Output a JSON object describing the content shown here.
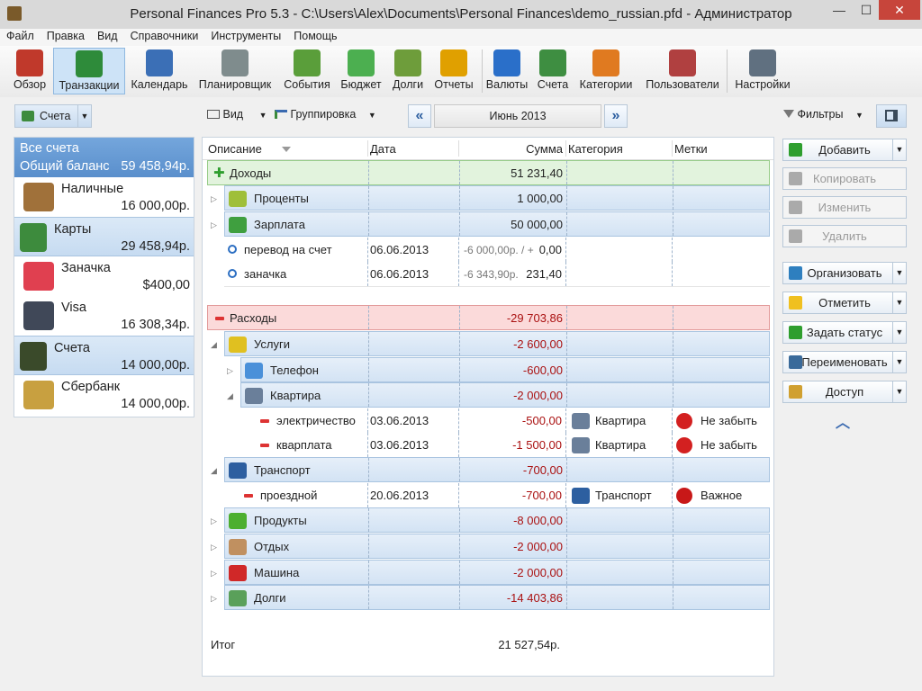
{
  "window": {
    "title": "Personal Finances Pro 5.3 - C:\\Users\\Alex\\Documents\\Personal Finances\\demo_russian.pfd - Администратор",
    "minimize": "—",
    "maximize": "☐",
    "close": "✕"
  },
  "menu": [
    "Файл",
    "Правка",
    "Вид",
    "Справочники",
    "Инструменты",
    "Помощь"
  ],
  "toolbar": [
    {
      "label": "Обзор",
      "color": "#c0392b"
    },
    {
      "label": "Транзакции",
      "color": "#2e8b3a"
    },
    {
      "label": "Календарь",
      "color": "#3b6fb6"
    },
    {
      "label": "Планировщик",
      "color": "#7f8c8d"
    },
    {
      "label": "События",
      "color": "#5a9e3a"
    },
    {
      "label": "Бюджет",
      "color": "#4caf50"
    },
    {
      "label": "Долги",
      "color": "#6e9d3b"
    },
    {
      "label": "Отчеты",
      "color": "#e0a000"
    },
    {
      "label": "Валюты",
      "color": "#2a6fc9"
    },
    {
      "label": "Счета",
      "color": "#3e8e41"
    },
    {
      "label": "Категории",
      "color": "#e07a20"
    },
    {
      "label": "Пользователи",
      "color": "#b04040"
    },
    {
      "label": "Настройки",
      "color": "#607080"
    }
  ],
  "subbar": {
    "accounts_btn": "Счета",
    "view_btn": "Вид",
    "group_btn": "Группировка",
    "period": "Июнь 2013",
    "filters_btn": "Фильтры"
  },
  "accounts": {
    "header_title": "Все счета",
    "header_total_label": "Общий баланс",
    "header_total": "59 458,94р.",
    "items": [
      {
        "name": "Наличные",
        "balance": "16 000,00р.",
        "group": false,
        "color": "#a0713a"
      },
      {
        "name": "Карты",
        "balance": "29 458,94р.",
        "group": true,
        "color": "#3d8b3d"
      },
      {
        "name": "Заначка",
        "balance": "$400,00",
        "group": false,
        "color": "#e04050"
      },
      {
        "name": "Visa",
        "balance": "16 308,34р.",
        "group": false,
        "color": "#404858"
      },
      {
        "name": "Счета",
        "balance": "14 000,00р.",
        "group": true,
        "color": "#3a4a2a"
      },
      {
        "name": "Сбербанк",
        "balance": "14 000,00р.",
        "group": false,
        "color": "#c8a040"
      }
    ]
  },
  "grid": {
    "columns": [
      "Описание",
      "Дата",
      "Сумма",
      "Категория",
      "Метки"
    ],
    "rows": [
      {
        "kind": "group-income",
        "desc": "Доходы",
        "amount": "51 231,40"
      },
      {
        "kind": "cat",
        "level": 1,
        "desc": "Проценты",
        "amount": "1 000,00",
        "icon": "#9fbf3a",
        "exp": "▷"
      },
      {
        "kind": "cat",
        "level": 1,
        "desc": "Зарплата",
        "amount": "50 000,00",
        "icon": "#3f9f3f",
        "exp": "▷"
      },
      {
        "kind": "txn-transfer",
        "desc": "перевод на счет",
        "date": "06.06.2013",
        "amount_gray": "-6 000,00р. / +",
        "amount": "0,00"
      },
      {
        "kind": "txn-transfer",
        "desc": "заначка",
        "date": "06.06.2013",
        "amount_gray": "-6 343,90р.",
        "amount": "231,40"
      },
      {
        "kind": "spacer"
      },
      {
        "kind": "group-expense",
        "desc": "Расходы",
        "amount": "-29 703,86"
      },
      {
        "kind": "cat",
        "level": 1,
        "desc": "Услуги",
        "amount": "-2 600,00",
        "icon": "#e0c020",
        "exp": "◢"
      },
      {
        "kind": "cat",
        "level": 2,
        "desc": "Телефон",
        "amount": "-600,00",
        "icon": "#4a90d9",
        "exp": "▷"
      },
      {
        "kind": "cat",
        "level": 2,
        "desc": "Квартира",
        "amount": "-2 000,00",
        "icon": "#6a7f9a",
        "exp": "◢"
      },
      {
        "kind": "txn",
        "level": 3,
        "desc": "электричество",
        "date": "03.06.2013",
        "amount": "-500,00",
        "category": "Квартира",
        "cat_icon": "#6a7f9a",
        "tag": "Не забыть",
        "tag_icon": "#d32020"
      },
      {
        "kind": "txn",
        "level": 3,
        "desc": "кварплата",
        "date": "03.06.2013",
        "amount": "-1 500,00",
        "category": "Квартира",
        "cat_icon": "#6a7f9a",
        "tag": "Не забыть",
        "tag_icon": "#d32020"
      },
      {
        "kind": "cat",
        "level": 1,
        "desc": "Транспорт",
        "amount": "-700,00",
        "icon": "#2d5fa0",
        "exp": "◢"
      },
      {
        "kind": "txn",
        "level": 2,
        "desc": "проездной",
        "date": "20.06.2013",
        "amount": "-700,00",
        "category": "Транспорт",
        "cat_icon": "#2d5fa0",
        "tag": "Важное",
        "tag_icon": "#c81818"
      },
      {
        "kind": "cat",
        "level": 1,
        "desc": "Продукты",
        "amount": "-8 000,00",
        "icon": "#4caf30",
        "exp": "▷"
      },
      {
        "kind": "cat",
        "level": 1,
        "desc": "Отдых",
        "amount": "-2 000,00",
        "icon": "#c09060",
        "exp": "▷"
      },
      {
        "kind": "cat",
        "level": 1,
        "desc": "Машина",
        "amount": "-2 000,00",
        "icon": "#d02828",
        "exp": "▷"
      },
      {
        "kind": "cat",
        "level": 1,
        "desc": "Долги",
        "amount": "-14 403,86",
        "icon": "#5aa05a",
        "exp": "▷"
      }
    ],
    "total_label": "Итог",
    "total": "21 527,54р."
  },
  "actions": [
    {
      "label": "Добавить",
      "enabled": true,
      "dropdown": true,
      "icon": "#2e9e2e"
    },
    {
      "label": "Копировать",
      "enabled": false,
      "dropdown": false,
      "icon": "#aaaaaa"
    },
    {
      "label": "Изменить",
      "enabled": false,
      "dropdown": false,
      "icon": "#aaaaaa"
    },
    {
      "label": "Удалить",
      "enabled": false,
      "dropdown": false,
      "icon": "#aaaaaa"
    },
    {
      "label": "Организовать",
      "enabled": true,
      "dropdown": true,
      "icon": "#2e7fbf"
    },
    {
      "label": "Отметить",
      "enabled": true,
      "dropdown": true,
      "icon": "#f0c020"
    },
    {
      "label": "Задать статус",
      "enabled": true,
      "dropdown": true,
      "icon": "#2e9e2e"
    },
    {
      "label": "Переименовать",
      "enabled": true,
      "dropdown": true,
      "icon": "#3a6a9a"
    },
    {
      "label": "Доступ",
      "enabled": true,
      "dropdown": true,
      "icon": "#d0a030"
    }
  ],
  "collapse_arrow": "︿"
}
